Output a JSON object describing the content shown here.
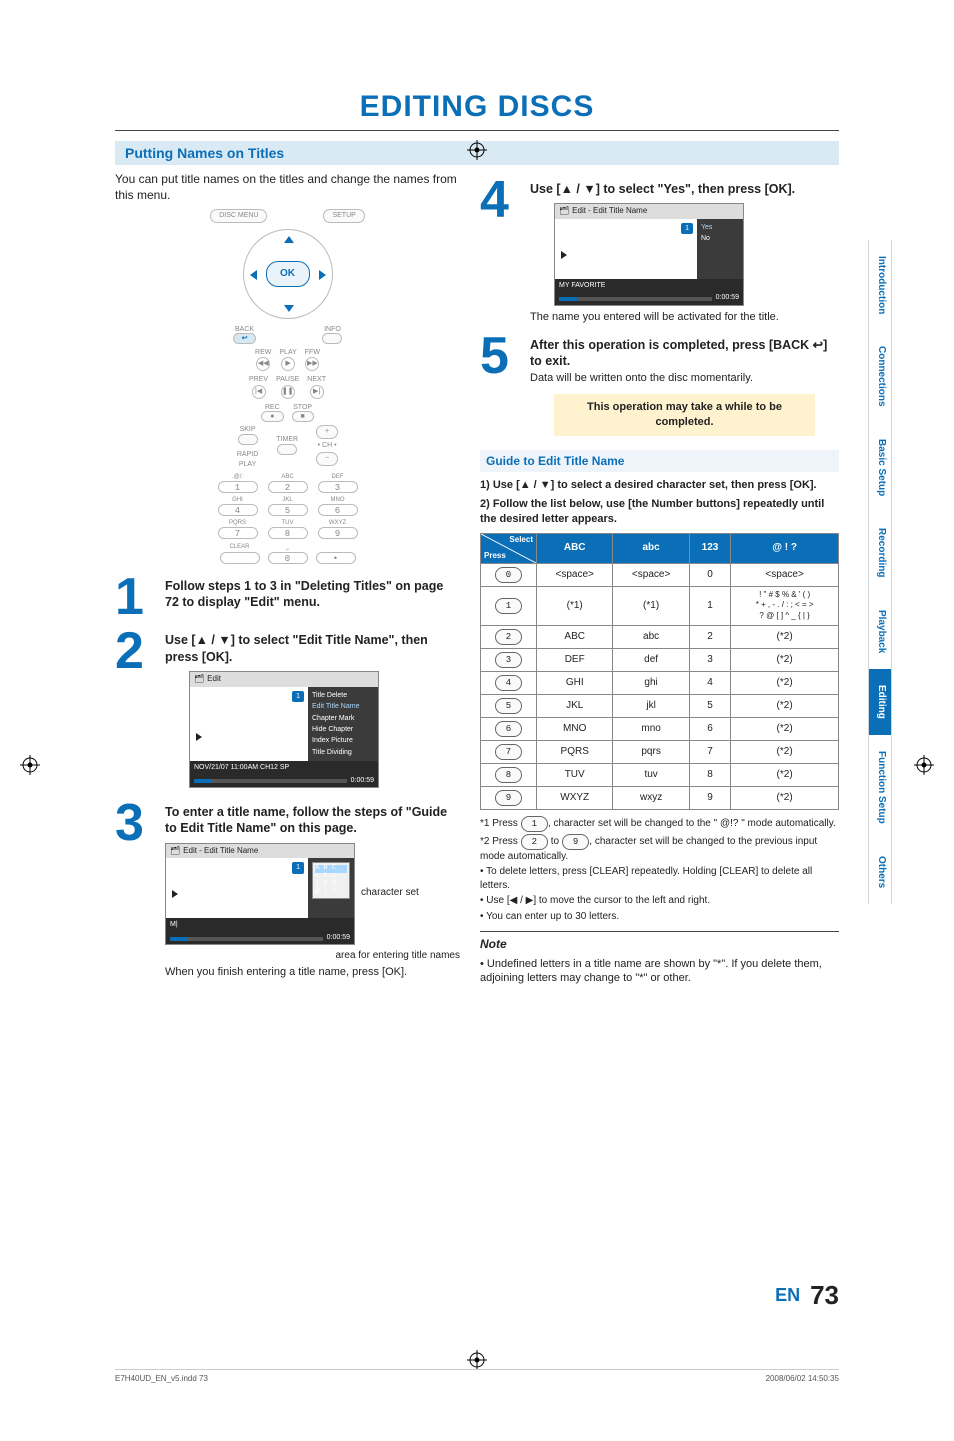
{
  "page": {
    "title": "EDITING DISCS",
    "lang_label": "EN",
    "number": "73",
    "imprint_left": "E7H40UD_EN_v5.indd   73",
    "imprint_right": "2008/06/02   14:50:35"
  },
  "side_tabs": [
    "Introduction",
    "Connections",
    "Basic Setup",
    "Recording",
    "Playback",
    "Editing",
    "Function Setup",
    "Others"
  ],
  "side_tabs_active_index": 5,
  "section": {
    "title": "Putting Names on Titles",
    "intro": "You can put title names on the titles and change the names from this menu."
  },
  "remote": {
    "top_row": {
      "disc_menu": "DISC MENU",
      "setup": "SETUP"
    },
    "ok": "OK",
    "labels": {
      "back": "BACK",
      "info": "INFO",
      "rew": "REW",
      "play": "PLAY",
      "ffw": "FFW",
      "prev": "PREV",
      "pause": "PAUSE",
      "next": "NEXT",
      "rec": "REC",
      "stop": "STOP",
      "skip": "SKIP",
      "timer": "TIMER",
      "rapid": "RAPID\nPLAY",
      "plus": "+",
      "minus": "−",
      "ch": "• CH •"
    },
    "keypad_labels": [
      ".@/:",
      "ABC",
      "DEF",
      "GHI",
      "JKL",
      "MNO",
      "PQRS",
      "TUV",
      "WXYZ"
    ],
    "keypad_digits": [
      "1",
      "2",
      "3",
      "4",
      "5",
      "6",
      "7",
      "8",
      "9"
    ],
    "bottom": {
      "clear": "CLEAR",
      "zero": "0",
      "dot": "•"
    }
  },
  "steps_left": [
    {
      "num": "1",
      "heading": "Follow steps 1 to 3 in \"Deleting Titles\" on page 72 to display \"Edit\" menu."
    },
    {
      "num": "2",
      "heading": "Use [▲ / ▼] to select \"Edit Title Name\", then press [OK]."
    },
    {
      "num": "3",
      "heading": "To enter a title name, follow the steps of \"Guide to Edit Title Name\" on this page."
    }
  ],
  "osd_edit": {
    "title": "Edit",
    "chip": "1",
    "menu": [
      "Title Delete",
      "Edit Title Name",
      "Chapter Mark",
      "Hide Chapter",
      "Index Picture",
      "Title Dividing"
    ],
    "menu_hl_index": 1,
    "footer_left": "NOV/21/07 11:00AM CH12 SP",
    "footer_right": "0:00:59"
  },
  "osd_name": {
    "title": "Edit - Edit Title Name",
    "chip": "1",
    "char_rows": [
      "A B C",
      "a b c",
      "1 2 3",
      "@ ! ?"
    ],
    "entry": "M|",
    "footer_right": "0:00:59"
  },
  "captions": {
    "character_set": "character set",
    "area": "area for entering title names",
    "after_entry": "When you finish entering a title name, press [OK]."
  },
  "steps_right": [
    {
      "num": "4",
      "heading": "Use [▲ / ▼] to select \"Yes\", then press [OK]."
    },
    {
      "num": "5",
      "heading": "After this operation is completed, press [BACK ↩] to exit.",
      "sub": "Data will be written onto the disc momentarily."
    }
  ],
  "osd_yes": {
    "title": "Edit - Edit Title Name",
    "chip": "1",
    "options": [
      "Yes",
      "No"
    ],
    "options_hl_index": 0,
    "footer_left": "MY FAVORITE",
    "footer_right": "0:00:59"
  },
  "after_yes_caption": "The name you entered will be activated for the title.",
  "yellow_box": "This operation may take a while to be completed.",
  "guide": {
    "bar": "Guide to Edit Title Name",
    "line1": "1) Use [▲ / ▼] to select a desired character set, then press [OK].",
    "line2": "2) Follow the list below, use [the Number buttons] repeatedly until the desired letter appears."
  },
  "char_table": {
    "diag_top": "Select",
    "diag_bottom": "Press",
    "headers": [
      "ABC",
      "abc",
      "123",
      "@ ! ?"
    ],
    "rows": [
      {
        "key": "0",
        "cells": [
          "<space>",
          "<space>",
          "0",
          "<space>"
        ]
      },
      {
        "key": "1",
        "cells": [
          "(*1)",
          "(*1)",
          "1",
          "! \" # $ % & ' ( )\n* + , - . / : ; < = >\n? @ [ ] ^ _ { | }"
        ]
      },
      {
        "key": "2",
        "cells": [
          "ABC",
          "abc",
          "2",
          "(*2)"
        ]
      },
      {
        "key": "3",
        "cells": [
          "DEF",
          "def",
          "3",
          "(*2)"
        ]
      },
      {
        "key": "4",
        "cells": [
          "GHI",
          "ghi",
          "4",
          "(*2)"
        ]
      },
      {
        "key": "5",
        "cells": [
          "JKL",
          "jkl",
          "5",
          "(*2)"
        ]
      },
      {
        "key": "6",
        "cells": [
          "MNO",
          "mno",
          "6",
          "(*2)"
        ]
      },
      {
        "key": "7",
        "cells": [
          "PQRS",
          "pqrs",
          "7",
          "(*2)"
        ]
      },
      {
        "key": "8",
        "cells": [
          "TUV",
          "tuv",
          "8",
          "(*2)"
        ]
      },
      {
        "key": "9",
        "cells": [
          "WXYZ",
          "wxyz",
          "9",
          "(*2)"
        ]
      }
    ]
  },
  "footnotes": [
    "*1 Press [ 1 ], character set will be changed to the \" @!? \" mode automatically.",
    "*2 Press [ 2 ] to [ 9 ], character set will be changed to the previous input mode automatically.",
    "• To delete letters, press [CLEAR] repeatedly. Holding [CLEAR] to delete all letters.",
    "• Use [◀ / ▶] to move the cursor to the left and right.",
    "• You can enter up to 30 letters."
  ],
  "note": {
    "head": "Note",
    "body": "• Undefined letters in a title name are shown by \"*\". If you delete them, adjoining letters may change to \"*\" or other."
  }
}
